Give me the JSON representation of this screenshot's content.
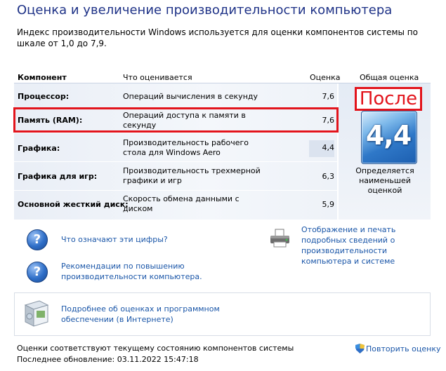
{
  "title": "Оценка и увеличение производительности компьютера",
  "description": "Индекс производительности Windows используется для оценки компонентов системы по шкале от 1,0 до 7,9.",
  "headers": {
    "component": "Компонент",
    "what": "Что оценивается",
    "score": "Оценка",
    "overall": "Общая оценка"
  },
  "rows": [
    {
      "component": "Процессор:",
      "what": "Операций вычисления в секунду",
      "score": "7,6"
    },
    {
      "component": "Память (RAM):",
      "what": "Операций доступа к памяти в секунду",
      "score": "7,6"
    },
    {
      "component": "Графика:",
      "what": "Производительность рабочего стола для Windows Aero",
      "score": "4,4"
    },
    {
      "component": "Графика для игр:",
      "what": "Производительность трехмерной графики и игр",
      "score": "6,3"
    },
    {
      "component": "Основной жесткий диск:",
      "what": "Скорость обмена данными с диском",
      "score": "5,9"
    }
  ],
  "overall_score": "4,4",
  "overall_note": "Определяется наименьшей оценкой",
  "annotation_label": "После",
  "links": {
    "what_numbers": "Что означают эти цифры?",
    "recommendations": "Рекомендации по повышению производительности компьютера.",
    "print_info": "Отображение и печать подробных сведений о производительности компьютера и системе",
    "online_info": "Подробнее об оценках и программном обеспечении (в Интернете)"
  },
  "footer": {
    "status": "Оценки соответствуют текущему состоянию компонентов системы",
    "last_update": "Последнее обновление: 03.11.2022 15:47:18",
    "rerun": "Повторить оценку"
  },
  "colors": {
    "accent": "#1e3287",
    "link": "#1a56a8",
    "annotation": "#e2141c"
  },
  "icons": [
    "question-icon",
    "printer-icon",
    "software-box-icon",
    "shield-icon"
  ]
}
